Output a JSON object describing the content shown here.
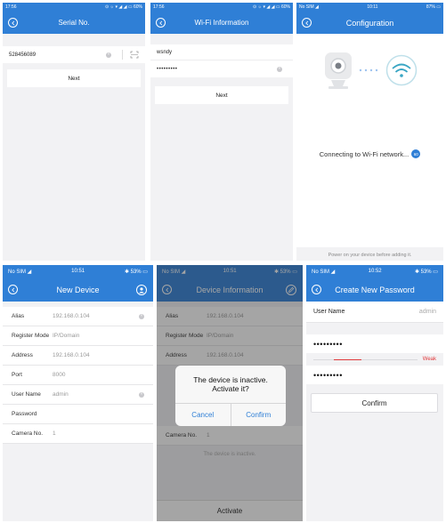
{
  "serial_screen": {
    "status_time": "17:56",
    "status_icons": "⊙ ☼ ▾ ◢ ◢ ▭ 60%",
    "title": "Serial No.",
    "serial_value": "528456089",
    "next_label": "Next"
  },
  "wifi_screen": {
    "status_time": "17:56",
    "status_icons": "⊙ ☼ ▾ ◢ ◢ ▭ 60%",
    "title": "Wi-Fi Information",
    "ssid_value": "wsndy",
    "password_value": "•••••••••",
    "next_label": "Next"
  },
  "config_screen": {
    "status_left": "No SIM ◢",
    "status_time": "10:11",
    "status_right": "87% ▭",
    "title": "Configuration",
    "progress_text": "Connecting to Wi-Fi network...",
    "progress_count": "60",
    "hint": "Power on your device before adding it."
  },
  "new_device_screen": {
    "status_left": "No SIM ◢",
    "status_time": "10:51",
    "status_right": "✱ 53% ▭",
    "title": "New Device",
    "fields": [
      {
        "label": "Alias",
        "value": "192.168.0.104"
      },
      {
        "label": "Register Mode",
        "value": "IP/Domain"
      },
      {
        "label": "Address",
        "value": "192.168.0.104"
      },
      {
        "label": "Port",
        "value": "8000"
      },
      {
        "label": "User Name",
        "value": "admin"
      },
      {
        "label": "Password",
        "value": ""
      },
      {
        "label": "Camera No.",
        "value": "1"
      }
    ]
  },
  "device_info_screen": {
    "status_left": "No SIM ◢",
    "status_time": "10:51",
    "status_right": "✱ 53% ▭",
    "title": "Device Information",
    "fields": [
      {
        "label": "Alias",
        "value": "192.168.0.104"
      },
      {
        "label": "Register Mode",
        "value": "IP/Domain"
      },
      {
        "label": "Address",
        "value": "192.168.0.104"
      }
    ],
    "camera_label": "Camera No.",
    "camera_value": "1",
    "inactive_note": "The device is inactive.",
    "activate_label": "Activate",
    "dialog": {
      "line1": "The device is inactive.",
      "line2": "Activate it?",
      "cancel_label": "Cancel",
      "confirm_label": "Confirm"
    }
  },
  "password_screen": {
    "status_left": "No SIM ◢",
    "status_time": "10:52",
    "status_right": "✱ 53% ▭",
    "title": "Create New Password",
    "user_label": "User Name",
    "user_value": "admin",
    "password_value": "•••••••••",
    "strength_label": "Weak",
    "confirm_password_value": "•••••••••",
    "confirm_label": "Confirm"
  },
  "colors": {
    "nav_blue": "#2f7fd6",
    "link_blue": "#2f7fd6",
    "weak_red": "#e0383a",
    "background": "#f2f2f4"
  },
  "icons": [
    "back-arrow-icon",
    "clear-icon",
    "scan-icon",
    "camera-icon",
    "wifi-icon",
    "edit-icon",
    "avatar-icon"
  ]
}
